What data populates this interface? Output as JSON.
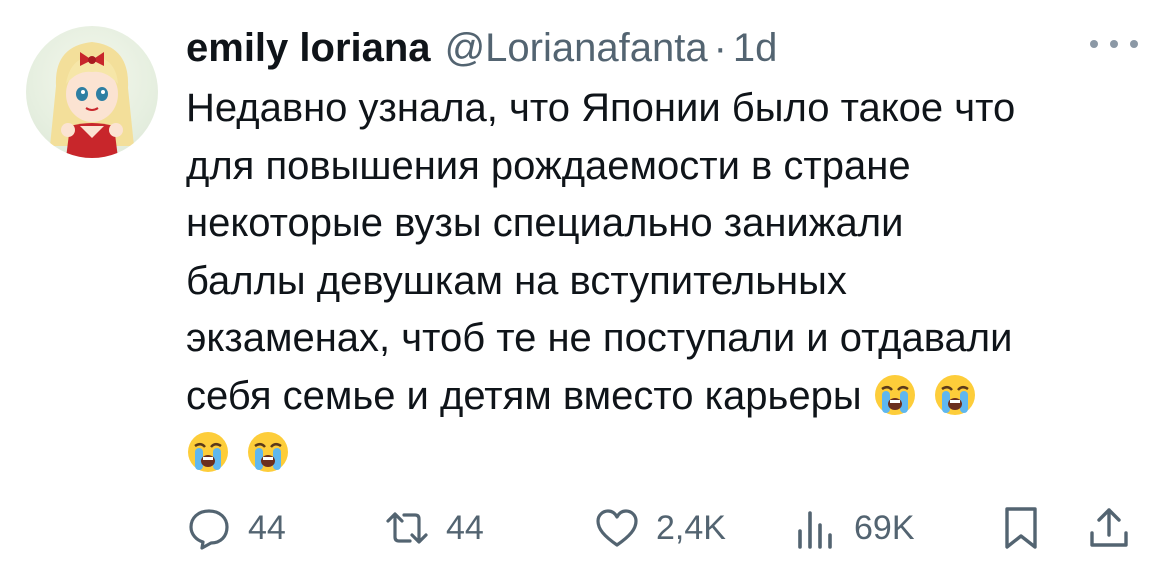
{
  "tweet": {
    "author_name": "emily loriana",
    "handle": "@Lorianafanta",
    "separator": "·",
    "time": "1d",
    "text": "Недавно узнала, что Японии было такое что\nдля повышения рождаемости в стране\nнекоторые вузы специально занижали\nбаллы девушкам на вступительных\nэкзаменах, чтоб те не поступали и отдавали\nсебя семье и детям вместо карьеры",
    "emoji_names": [
      "loudly-crying-face",
      "loudly-crying-face",
      "loudly-crying-face",
      "loudly-crying-face"
    ]
  },
  "actions": {
    "replies": "44",
    "retweets": "44",
    "likes": "2,4K",
    "views": "69K"
  },
  "icons": {
    "reply": "reply-icon",
    "retweet": "retweet-icon",
    "like": "heart-icon",
    "views": "views-icon",
    "bookmark": "bookmark-icon",
    "share": "share-icon",
    "more": "more-icon"
  },
  "colors": {
    "text": "#0f1419",
    "secondary": "#536471"
  }
}
